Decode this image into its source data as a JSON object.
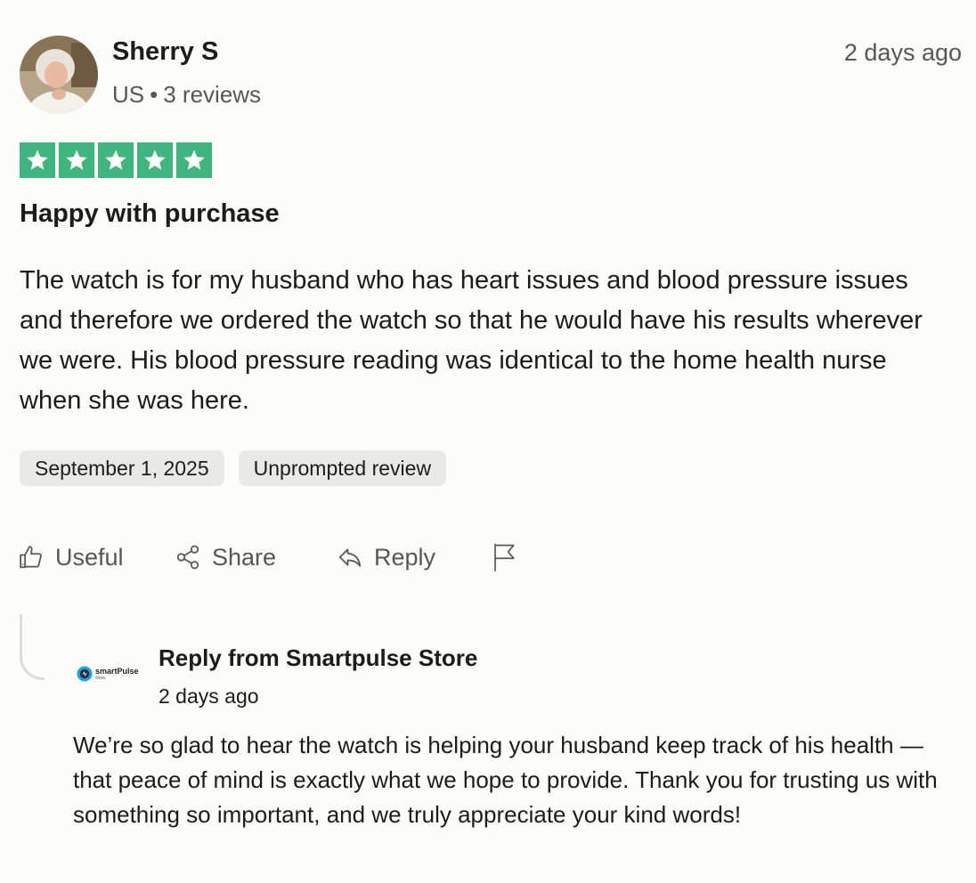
{
  "reviewer": {
    "name": "Sherry S",
    "country": "US",
    "separator": "•",
    "review_count": "3 reviews"
  },
  "posted_ago": "2 days ago",
  "rating": {
    "stars": 5,
    "max": 5,
    "color": "#3fb67d"
  },
  "review": {
    "title": "Happy with purchase",
    "body": "The watch is for my husband who has heart issues and blood pressure issues and therefore we ordered the watch so that he would have his results wherever we were. His blood pressure reading was identical to the home health nurse when she was here."
  },
  "tags": {
    "date": "September 1, 2025",
    "type": "Unprompted review"
  },
  "actions": {
    "useful": {
      "label": "Useful",
      "icon": "thumbs-up-icon"
    },
    "share": {
      "label": "Share",
      "icon": "share-icon"
    },
    "reply": {
      "label": "Reply",
      "icon": "reply-arrow-icon"
    },
    "report": {
      "icon": "flag-icon"
    }
  },
  "company_reply": {
    "logo_text": "smartPulse",
    "logo_subtext": "store.",
    "header": "Reply from Smartpulse Store",
    "posted_ago": "2 days ago",
    "body": "We’re so glad to hear the watch is helping your husband keep track of his health — that peace of mind is exactly what we hope to provide. Thank you for trusting us with something so important, and we truly appreciate your kind words!"
  }
}
